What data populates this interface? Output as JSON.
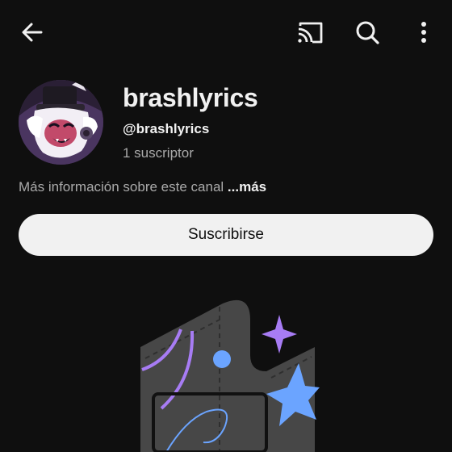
{
  "topbar": {
    "back_icon": "arrow-left-icon",
    "cast_icon": "cast-icon",
    "search_icon": "search-icon",
    "more_icon": "more-vertical-icon"
  },
  "channel": {
    "name": "brashlyrics",
    "handle": "@brashlyrics",
    "subscribers": "1 suscriptor",
    "about": "Más información sobre este canal ",
    "about_more": "...más"
  },
  "subscribe": {
    "label": "Suscribirse"
  },
  "colors": {
    "background": "#0f0f0f",
    "text_primary": "#f1f1f1",
    "text_secondary": "#aaaaaa",
    "button_bg": "#f1f1f1",
    "accent_purple": "#a77cf4",
    "accent_blue": "#6ba4ff",
    "illustration_gray": "#474747"
  }
}
